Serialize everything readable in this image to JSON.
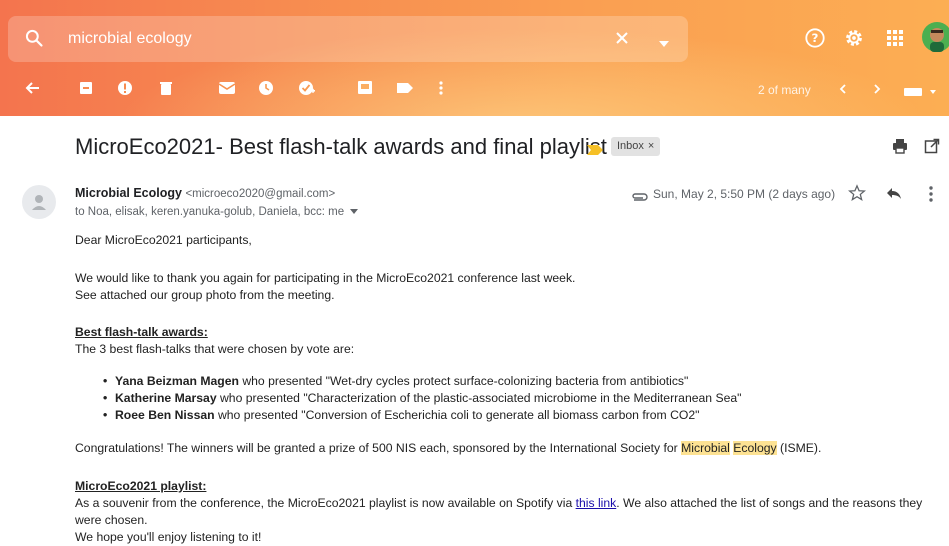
{
  "search": {
    "query": "microbial ecology"
  },
  "toolbar": {
    "pager": "2 of many"
  },
  "email": {
    "subject": "MicroEco2021- Best flash-talk awards and final playlist",
    "label_chip": "Inbox",
    "sender_name": "Microbial Ecology",
    "sender_email": "<microeco2020@gmail.com>",
    "recipients": "to Noa, elisak, keren.yanuka-golub, Daniela, bcc: me",
    "date": "Sun, May 2, 5:50 PM (2 days ago)",
    "greeting": "Dear MicroEco2021 participants,",
    "para1": "We would like to thank you again for participating in the MicroEco2021 conference last week.",
    "para2": "See attached our group photo from the meeting.",
    "awards_heading": "Best flash-talk awards:",
    "awards_intro": "The 3 best flash-talks that were chosen by vote are:",
    "winners": [
      {
        "name": "Yana Beizman Magen",
        "text": " who presented \"Wet-dry cycles protect surface-colonizing bacteria from antibiotics\""
      },
      {
        "name": "Katherine Marsay",
        "text": " who presented \"Characterization of the plastic-associated microbiome in the Mediterranean Sea\""
      },
      {
        "name": "Roee Ben Nissan",
        "text": " who presented \"Conversion of Escherichia coli to generate all biomass carbon from CO2\""
      }
    ],
    "congrats_pre": "Congratulations! The winners will be granted a prize of 500 NIS each, sponsored by the International Society for ",
    "congrats_hl1": "Microbial",
    "congrats_hl2": "Ecology",
    "congrats_post": " (ISME).",
    "playlist_heading": "MicroEco2021 playlist:",
    "playlist_pre": "As a souvenir from the conference, the MicroEco2021 playlist is now available on Spotify via ",
    "playlist_link": "this link",
    "playlist_post": ". We also attached the list of songs and the reasons they",
    "playlist_cont": "were chosen.",
    "closing": "We hope you'll enjoy listening to it!"
  },
  "colors": {
    "header_start": "#f4744e",
    "header_end": "#fcae53",
    "highlight": "#fde293",
    "link": "#1a0dab"
  }
}
